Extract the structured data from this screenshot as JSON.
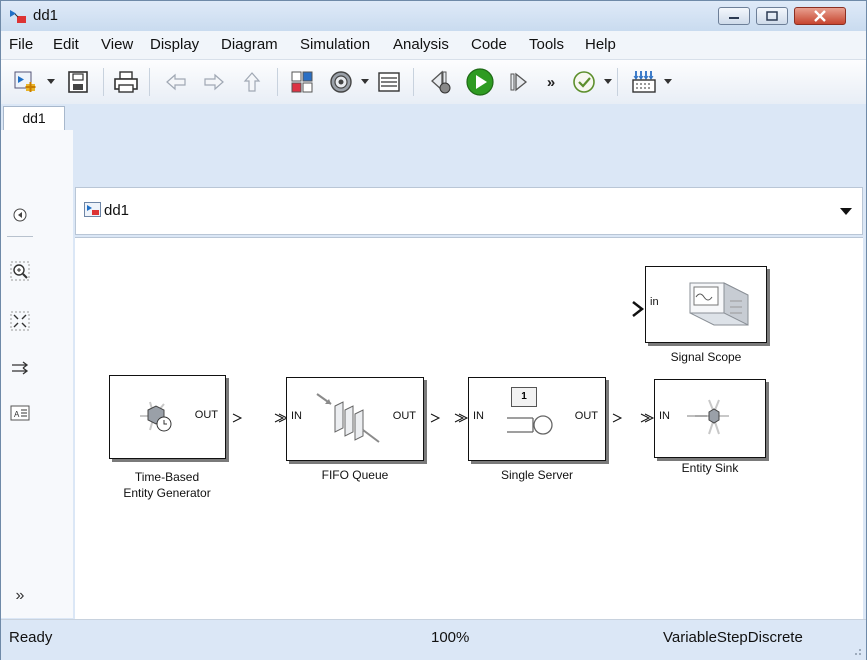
{
  "window": {
    "title": "dd1"
  },
  "menu": [
    "File",
    "Edit",
    "View",
    "Display",
    "Diagram",
    "Simulation",
    "Analysis",
    "Code",
    "Tools",
    "Help"
  ],
  "tab": {
    "label": "dd1"
  },
  "address": {
    "label": "dd1"
  },
  "blocks": {
    "generator": {
      "label_line1": "Time-Based",
      "label_line2": "Entity Generator",
      "out_port": "OUT"
    },
    "queue": {
      "label": "FIFO Queue",
      "in_port": "IN",
      "out_port": "OUT"
    },
    "server": {
      "label": "Single Server",
      "in_port": "IN",
      "out_port": "OUT",
      "count": "1"
    },
    "sink": {
      "label": "Entity Sink",
      "in_port": "IN"
    },
    "scope": {
      "label": "Signal Scope",
      "in_port": "in"
    }
  },
  "status": {
    "state": "Ready",
    "zoom": "100%",
    "solver": "VariableStepDiscrete"
  },
  "colors": {
    "accent": "#0b5fb8",
    "play": "#2e9b22",
    "close": "#c7452f"
  }
}
